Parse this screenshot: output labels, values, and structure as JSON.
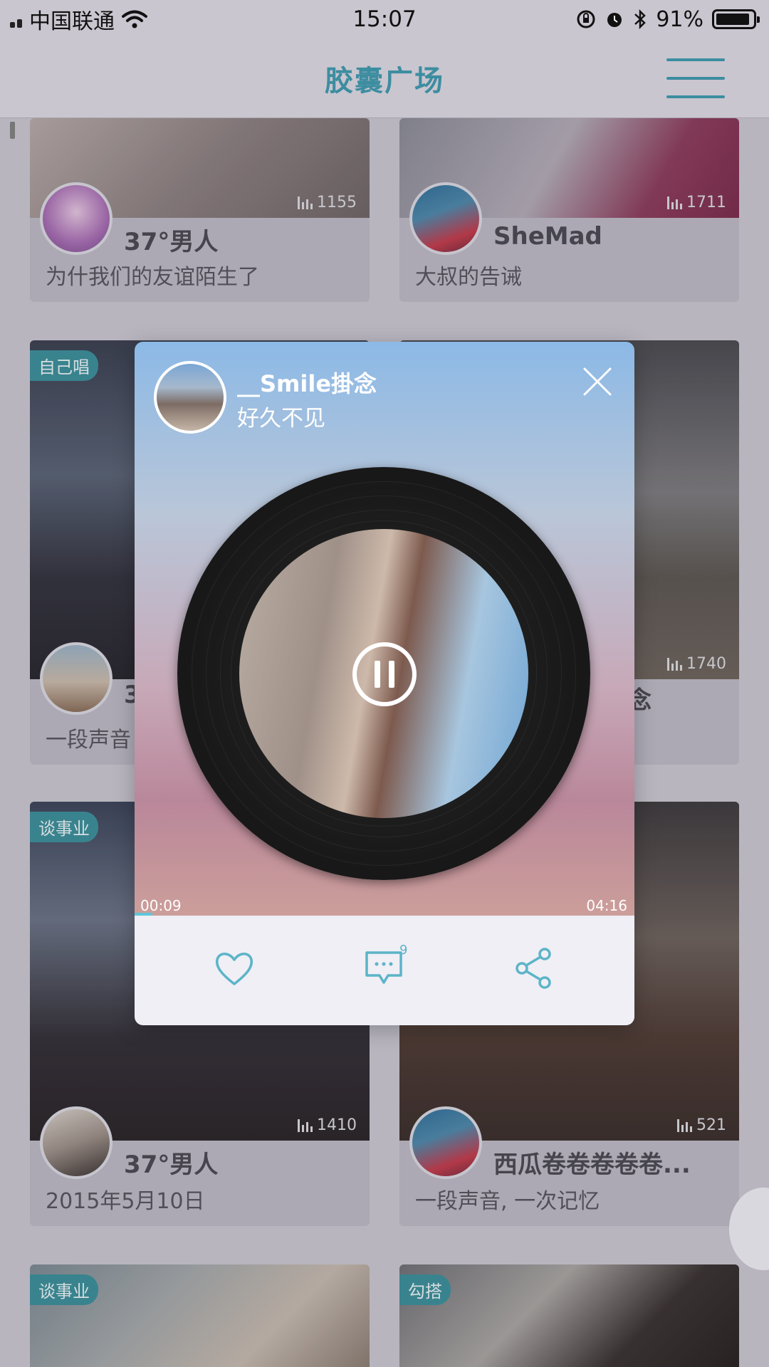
{
  "status_bar": {
    "carrier": "中国联通",
    "time": "15:07",
    "battery": "91%",
    "battery_level": 0.91
  },
  "navbar": {
    "title": "胶囊广场"
  },
  "feed": {
    "cards": [
      {
        "tag": "",
        "plays": "1155",
        "name": "37°男人",
        "desc": "为什我们的友谊陌生了"
      },
      {
        "tag": "",
        "plays": "1711",
        "name": "SheMad",
        "desc": "大叔的告诫"
      },
      {
        "tag": "自己唱",
        "plays": "",
        "name": "3",
        "desc": "一段声音"
      },
      {
        "tag": "",
        "plays": "1740",
        "name": "念",
        "desc": ""
      },
      {
        "tag": "谈事业",
        "plays": "1410",
        "name": "37°男人",
        "desc": "2015年5月10日"
      },
      {
        "tag": "",
        "plays": "521",
        "name": "西瓜卷卷卷卷卷...",
        "desc": "一段声音, 一次记忆"
      },
      {
        "tag": "谈事业",
        "plays": "",
        "name": "",
        "desc": ""
      },
      {
        "tag": "勾搭",
        "plays": "",
        "name": "",
        "desc": ""
      }
    ]
  },
  "player": {
    "user_name": "__Smile掛念",
    "track_title": "好久不见",
    "time_current": "00:09",
    "time_total": "04:16",
    "progress": 0.035,
    "comment_count": "9",
    "actions": [
      "heart-icon",
      "comment-icon",
      "share-icon"
    ]
  },
  "colors": {
    "accent": "#3d8da0",
    "action_icon": "#5cb4c8",
    "tag_bg": "#3c8e98"
  }
}
